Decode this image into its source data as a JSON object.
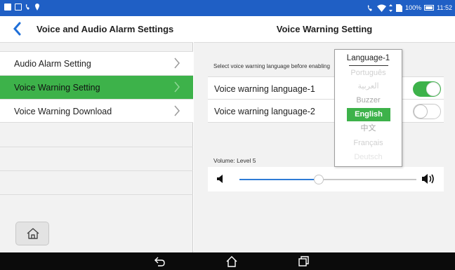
{
  "status_bar": {
    "battery_text": "100%",
    "time": "11:52"
  },
  "left_panel": {
    "title": "Voice and Audio Alarm Settings",
    "items": [
      {
        "label": "Audio Alarm Setting",
        "active": false
      },
      {
        "label": "Voice Warning Setting",
        "active": true
      },
      {
        "label": "Voice Warning Download",
        "active": false
      }
    ]
  },
  "right_panel": {
    "title": "Voice Warning Setting",
    "hint": "Select voice warning language before enabling",
    "rows": [
      {
        "label": "Voice warning language-1",
        "toggle": "on"
      },
      {
        "label": "Voice warning language-2",
        "toggle": "off"
      }
    ],
    "volume": {
      "label": "Volume: Level 5",
      "value_fraction": 0.45
    }
  },
  "dropdown": {
    "title": "Language-1",
    "options": [
      "Português",
      "العربية",
      "Buzzer",
      "English",
      "中文",
      "Français",
      "Deutsch"
    ],
    "selected": "English"
  },
  "colors": {
    "status_bar": "#1f5fc5",
    "accent_green": "#3db24a",
    "link_blue": "#1f6fd8"
  }
}
